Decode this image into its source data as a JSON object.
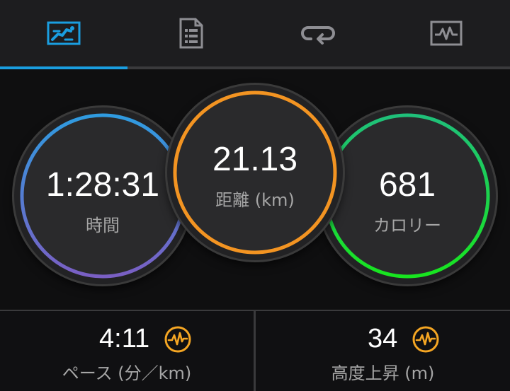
{
  "tabs": [
    {
      "icon": "run-summary-icon",
      "active": true
    },
    {
      "icon": "details-list-icon",
      "active": false
    },
    {
      "icon": "laps-loop-icon",
      "active": false
    },
    {
      "icon": "chart-graph-icon",
      "active": false
    }
  ],
  "colors": {
    "active_tab": "#1a9ee0",
    "time_ring": [
      "#2f9be0",
      "#7a5fc4"
    ],
    "distance_ring": "#f39422",
    "calories_ring": [
      "#1fc07a",
      "#18e51f"
    ],
    "hr_icon": "#f5a623"
  },
  "metrics": {
    "time": {
      "value": "1:28:31",
      "label": "時間"
    },
    "distance": {
      "value": "21.13",
      "label": "距離 (km)"
    },
    "calories": {
      "value": "681",
      "label": "カロリー"
    }
  },
  "stats": {
    "pace": {
      "value": "4:11",
      "label": "ペース (分／km)",
      "icon": "heart-rate-icon"
    },
    "elevation": {
      "value": "34",
      "label": "高度上昇 (m)",
      "icon": "heart-rate-icon"
    }
  }
}
